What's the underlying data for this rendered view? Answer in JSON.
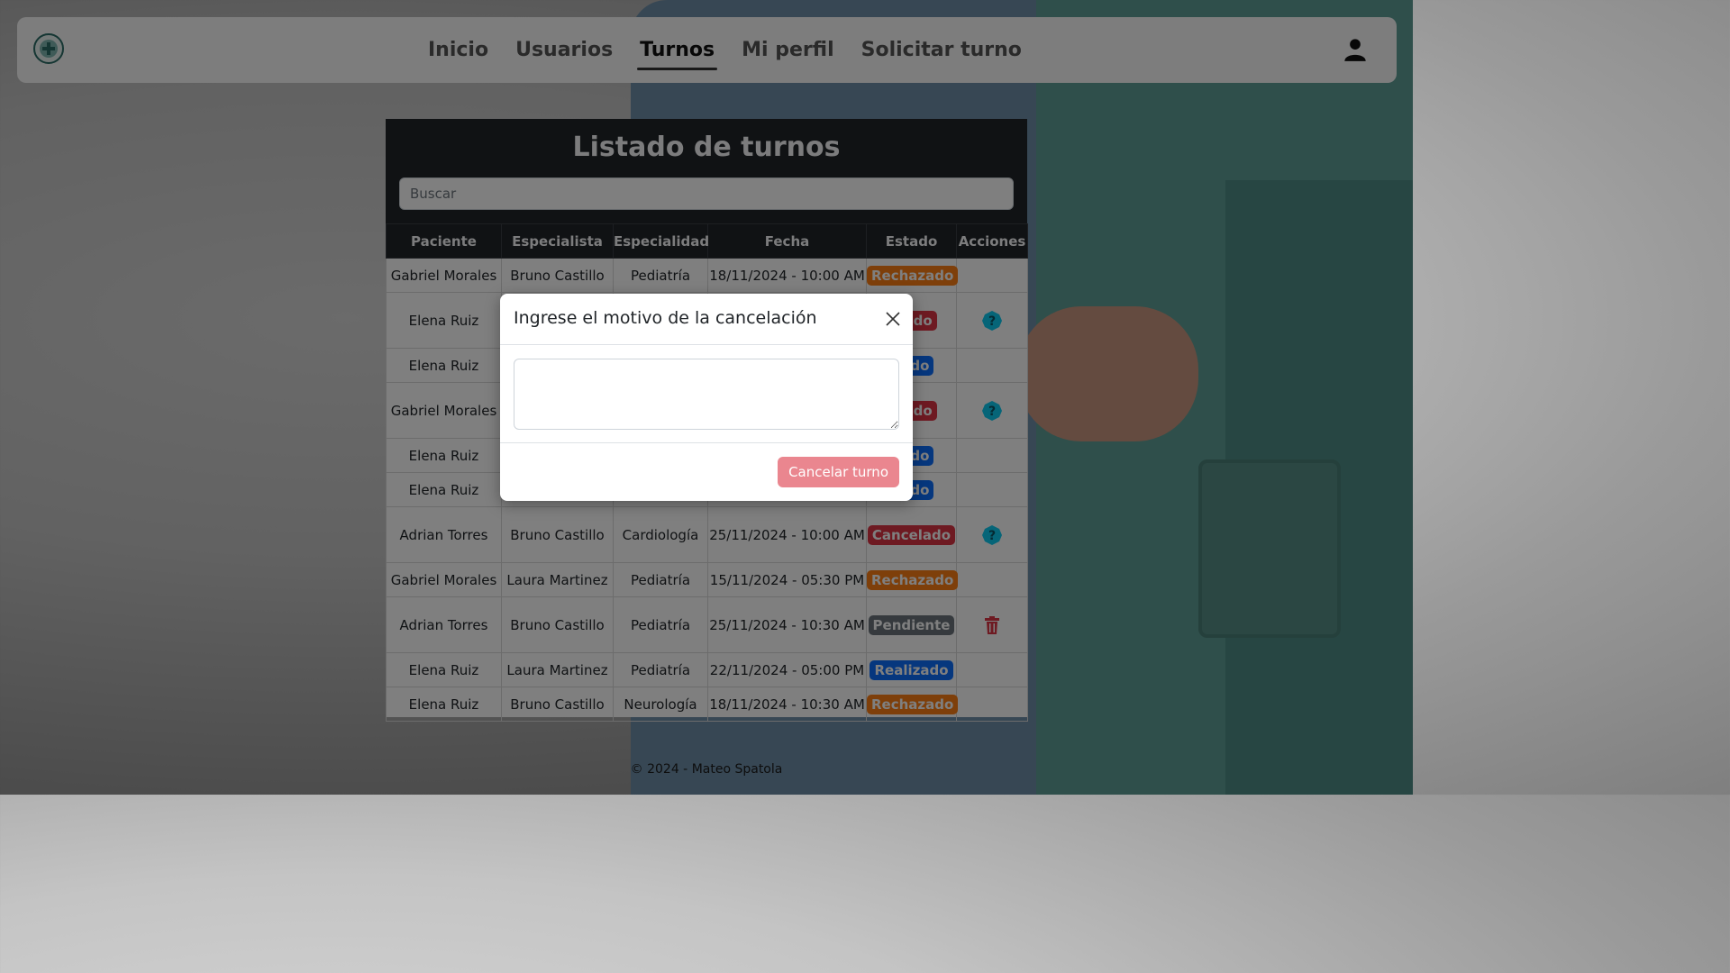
{
  "nav": {
    "links": [
      "Inicio",
      "Usuarios",
      "Turnos",
      "Mi perfil",
      "Solicitar turno"
    ],
    "active": "Turnos"
  },
  "panel": {
    "title": "Listado de turnos",
    "search_placeholder": "Buscar",
    "headers": [
      "Paciente",
      "Especialista",
      "Especialidad",
      "Fecha",
      "Estado",
      "Acciones"
    ],
    "rows": [
      {
        "paciente": "Gabriel Morales",
        "especialista": "Bruno Castillo",
        "especialidad": "Pediatría",
        "fecha": "18/11/2024 - 10:00 AM",
        "estado": "Rechazado",
        "accion": ""
      },
      {
        "paciente": "Elena Ruiz",
        "especialista": "",
        "especialidad": "",
        "fecha": "",
        "estado": "elado",
        "accion": "help"
      },
      {
        "paciente": "Elena Ruiz",
        "especialista": "",
        "especialidad": "",
        "fecha": "",
        "estado": "zado",
        "accion": ""
      },
      {
        "paciente": "Gabriel Morales",
        "especialista": "",
        "especialidad": "",
        "fecha": "",
        "estado": "elado",
        "accion": "help"
      },
      {
        "paciente": "Elena Ruiz",
        "especialista": "",
        "especialidad": "",
        "fecha": "",
        "estado": "zado",
        "accion": ""
      },
      {
        "paciente": "Elena Ruiz",
        "especialista": "",
        "especialidad": "",
        "fecha": "",
        "estado": "zado",
        "accion": ""
      },
      {
        "paciente": "Adrian Torres",
        "especialista": "Bruno Castillo",
        "especialidad": "Cardiología",
        "fecha": "25/11/2024 - 10:00 AM",
        "estado": "Cancelado",
        "accion": "help"
      },
      {
        "paciente": "Gabriel Morales",
        "especialista": "Laura Martinez",
        "especialidad": "Pediatría",
        "fecha": "15/11/2024 - 05:30 PM",
        "estado": "Rechazado",
        "accion": ""
      },
      {
        "paciente": "Adrian Torres",
        "especialista": "Bruno Castillo",
        "especialidad": "Pediatría",
        "fecha": "25/11/2024 - 10:30 AM",
        "estado": "Pendiente",
        "accion": "delete"
      },
      {
        "paciente": "Elena Ruiz",
        "especialista": "Laura Martinez",
        "especialidad": "Pediatría",
        "fecha": "22/11/2024 - 05:00 PM",
        "estado": "Realizado",
        "accion": ""
      },
      {
        "paciente": "Elena Ruiz",
        "especialista": "Bruno Castillo",
        "especialidad": "Neurología",
        "fecha": "18/11/2024 - 10:30 AM",
        "estado": "Rechazado",
        "accion": ""
      }
    ]
  },
  "modal": {
    "title": "Ingrese el motivo de la cancelación",
    "textarea_value": "",
    "submit_label": "Cancelar turno",
    "close_icon": "close-icon"
  },
  "footer": {
    "text": "© 2024 - Mateo Spatola"
  },
  "colors": {
    "rechazado": "#fd7e14",
    "cancelado": "#dc3545",
    "realizado": "#0d6efd",
    "pendiente": "#6c757d",
    "help_icon": "#0dcaf0",
    "delete_icon": "#dc3545"
  },
  "icons": {
    "logo": "medical-logo-icon",
    "user": "user-icon",
    "help": "question-circle-icon",
    "delete": "trash-icon"
  }
}
